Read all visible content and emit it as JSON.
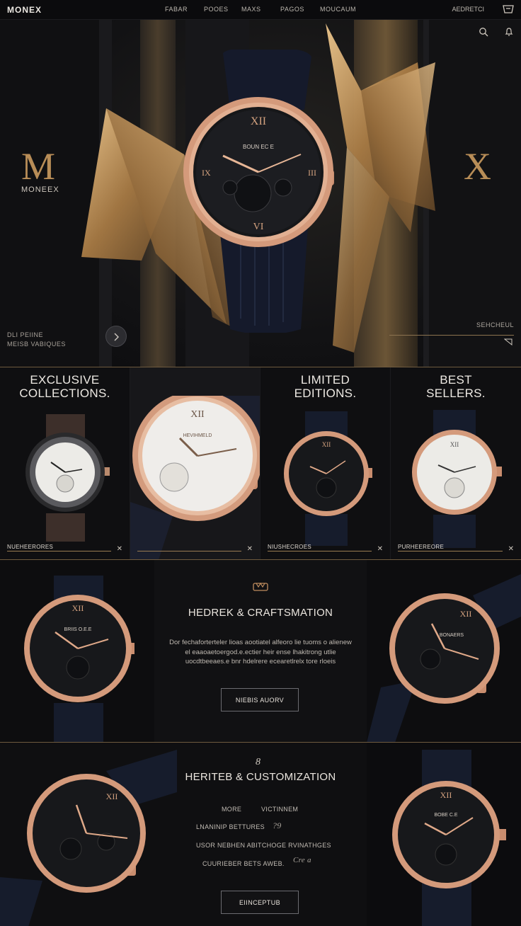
{
  "nav": {
    "brand": "MONEX",
    "items": [
      "FABAR",
      "POOES",
      "MAXS",
      "PAGOS",
      "MOUCAUM"
    ],
    "right_label": "AEDRETCI",
    "cart_icon": "bag-icon"
  },
  "hero": {
    "monogram": "M",
    "brand": "MONEEX",
    "letter_right": "X",
    "dial_text": "BOUN EC E",
    "sub_line_1": "DLI PEIINE",
    "sub_line_2": "MEISB VABIQUES",
    "search_label": "SEHCHEUL",
    "colors": {
      "gold": "#b88d57",
      "rose_gold": "#d49a7b"
    }
  },
  "collections": [
    {
      "title_line_1": "EXCLUSIVE",
      "title_line_2": "COLLECTIONS.",
      "tag": "NUEHEERORES"
    },
    {
      "title_line_1": "",
      "title_line_2": "",
      "tag": "",
      "dial_text": "HEVIHMELD"
    },
    {
      "title_line_1": "LIMITED",
      "title_line_2": "EDITIONS.",
      "tag": "NIUSHECROES"
    },
    {
      "title_line_1": "BEST",
      "title_line_2": "SELLERS.",
      "tag": "PURHEEREORE"
    }
  ],
  "heritage": {
    "title": "HEDREK & CRAFTSMATION",
    "body": "Dor fechaforterteler lioas aootiatel alfeoro lie tuoms o alienew el eaaoaetoergod.e.ectier heir ense lhakitrong utlie uocdtbeeaes.e bnr hdelrere ecearetlrelx tore rloeis",
    "button": "NIEBIS AUORV",
    "dial_left": "BRIIS O.E.E",
    "dial_right": "BONAERS"
  },
  "customization": {
    "icon": "8",
    "title": "HERITEB & CUSTOMIZATION",
    "opt_a": "MORE",
    "opt_b": "VICTINNEM",
    "opt_c": "LNANINIP BETTURES",
    "opt_c_mark": "?9",
    "opt_d": "USOR NEBHEN ABITCHOGE RVINATHGES",
    "opt_e": "CUURIEBER BETS AWEB.",
    "opt_e_mark": "Cre a",
    "button": "EIINCEPTUB",
    "dial_right": "BOBE C.E"
  }
}
